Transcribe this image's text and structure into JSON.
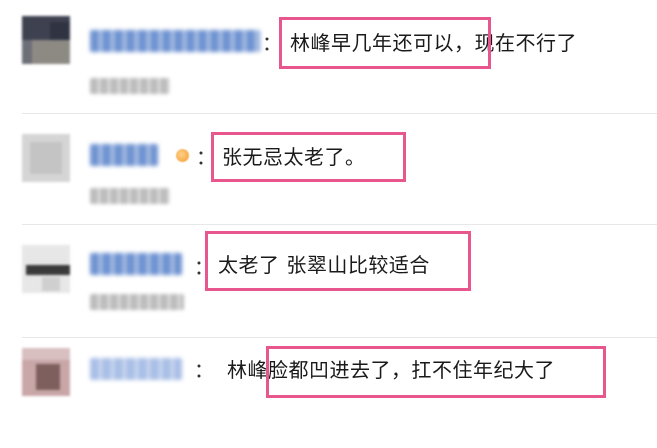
{
  "comments": [
    {
      "username_icon": "blurred-username",
      "text": "林峰早几年还可以，现在不行了",
      "colon": "："
    },
    {
      "username_icon": "blurred-username",
      "badge": "vip-badge-icon",
      "text": "张无忌太老了。",
      "colon": "："
    },
    {
      "username_icon": "blurred-username",
      "text": "太老了 张翠山比较适合",
      "colon": "："
    },
    {
      "username_icon": "blurred-username",
      "text": "林峰脸都凹进去了，扛不住年纪大了",
      "colon": "："
    }
  ],
  "colors": {
    "highlight": "#e8568e",
    "username": "#6f93d1",
    "text": "#1a1a1a"
  }
}
